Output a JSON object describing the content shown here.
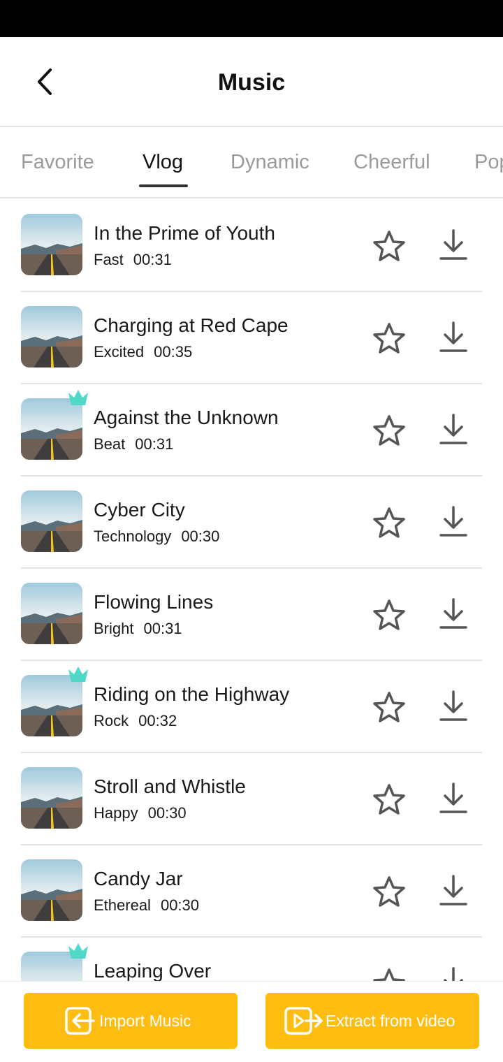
{
  "header": {
    "title": "Music"
  },
  "tabs": [
    {
      "label": "Favorite"
    },
    {
      "label": "Vlog"
    },
    {
      "label": "Dynamic"
    },
    {
      "label": "Cheerful"
    },
    {
      "label": "Pop"
    }
  ],
  "active_tab": "Vlog",
  "songs": [
    {
      "title": "In the Prime of Youth",
      "mood": "Fast",
      "duration": "00:31",
      "premium": false
    },
    {
      "title": "Charging at Red Cape",
      "mood": "Excited",
      "duration": "00:35",
      "premium": false
    },
    {
      "title": "Against the Unknown",
      "mood": "Beat",
      "duration": "00:31",
      "premium": true
    },
    {
      "title": "Cyber City",
      "mood": "Technology",
      "duration": "00:30",
      "premium": false
    },
    {
      "title": "Flowing Lines",
      "mood": "Bright",
      "duration": "00:31",
      "premium": false
    },
    {
      "title": "Riding on the Highway",
      "mood": "Rock",
      "duration": "00:32",
      "premium": true
    },
    {
      "title": "Stroll and Whistle",
      "mood": "Happy",
      "duration": "00:30",
      "premium": false
    },
    {
      "title": "Candy Jar",
      "mood": "Ethereal",
      "duration": "00:30",
      "premium": false
    },
    {
      "title": "Leaping Over",
      "mood": "",
      "duration": "",
      "premium": true
    }
  ],
  "actions": {
    "import_label": "Import Music",
    "extract_label": "Extract from video"
  },
  "colors": {
    "accent": "#ffbd12",
    "crown": "#4fd8c8"
  },
  "icons": {
    "back": "chevron-left-icon",
    "favorite": "star-outline-icon",
    "download": "download-icon",
    "premium": "crown-icon",
    "import": "import-arrow-icon",
    "extract": "video-extract-icon"
  }
}
